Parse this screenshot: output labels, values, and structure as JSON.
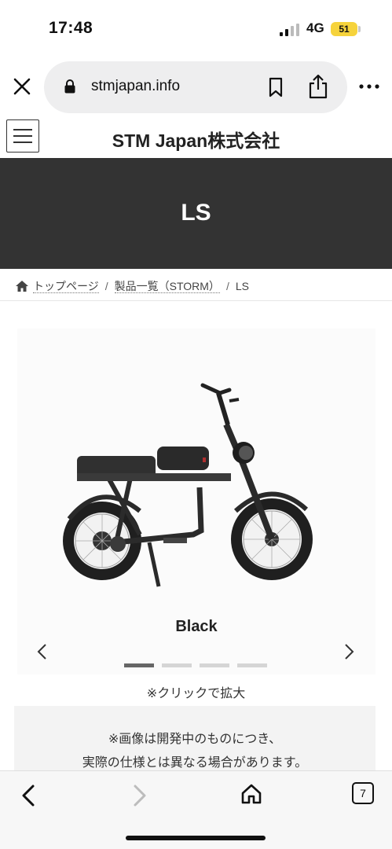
{
  "status_bar": {
    "time": "17:48",
    "network": "4G",
    "battery": "51"
  },
  "browser": {
    "url": "stmjapan.info",
    "tab_count": "7"
  },
  "site": {
    "title": "STM Japan株式会社"
  },
  "hero": {
    "title": "LS"
  },
  "breadcrumb": {
    "home": "トップページ",
    "category": "製品一覧（STORM）",
    "current": "LS",
    "separator": "/"
  },
  "carousel": {
    "color_label": "Black",
    "slide_count": 4,
    "active_index": 0
  },
  "click_note": "※クリックで拡大",
  "notice": {
    "line1": "※画像は開発中のものにつき、",
    "line2": "実際の仕様とは異なる場合があります。"
  },
  "colors": {
    "hero_bg": "#333333",
    "active_dot": "#666666",
    "inactive_dot": "#d5d5d5",
    "battery": "#f6d33c"
  },
  "icons": [
    "close-icon",
    "lock-icon",
    "bookmark-icon",
    "share-icon",
    "more-icon",
    "hamburger-icon",
    "home-icon",
    "chevron-left-icon",
    "chevron-right-icon",
    "back-icon",
    "forward-icon",
    "tabs-icon"
  ]
}
